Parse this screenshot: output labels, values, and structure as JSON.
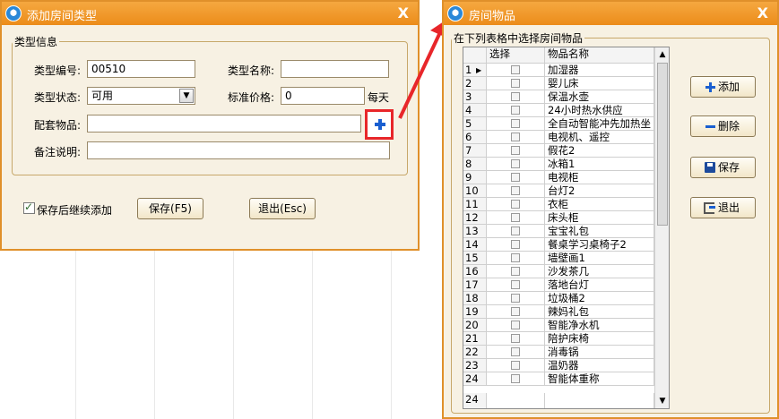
{
  "left_dialog": {
    "title": "添加房间类型",
    "close_label": "X",
    "group_title": "类型信息",
    "type_code_label": "类型编号:",
    "type_code_value": "00510",
    "type_name_label": "类型名称:",
    "type_name_value": "",
    "type_status_label": "类型状态:",
    "type_status_value": "可用",
    "price_label": "标准价格:",
    "price_value": "0",
    "price_unit": "每天",
    "items_label": "配套物品:",
    "items_value": "",
    "remark_label": "备注说明:",
    "remark_value": "",
    "continue_label": "保存后继续添加",
    "continue_checked": true,
    "save_label": "保存(F5)",
    "exit_label": "退出(Esc)"
  },
  "right_dialog": {
    "title": "房间物品",
    "close_label": "X",
    "group_title": "在下列表格中选择房间物品",
    "col_select": "选择",
    "col_name": "物品名称",
    "rows": [
      {
        "no": "1",
        "name": "加湿器"
      },
      {
        "no": "2",
        "name": "婴儿床"
      },
      {
        "no": "3",
        "name": "保温水壶"
      },
      {
        "no": "4",
        "name": "24小时热水供应"
      },
      {
        "no": "5",
        "name": "全自动智能冲先加热坐"
      },
      {
        "no": "6",
        "name": "电视机、遥控"
      },
      {
        "no": "7",
        "name": "假花2"
      },
      {
        "no": "8",
        "name": "冰箱1"
      },
      {
        "no": "9",
        "name": "电视柜"
      },
      {
        "no": "10",
        "name": "台灯2"
      },
      {
        "no": "11",
        "name": "衣柜"
      },
      {
        "no": "12",
        "name": "床头柜"
      },
      {
        "no": "13",
        "name": "宝宝礼包"
      },
      {
        "no": "14",
        "name": "餐桌学习桌椅子2"
      },
      {
        "no": "15",
        "name": "墙壁画1"
      },
      {
        "no": "16",
        "name": "沙发茶几"
      },
      {
        "no": "17",
        "name": "落地台灯"
      },
      {
        "no": "18",
        "name": "垃圾桶2"
      },
      {
        "no": "19",
        "name": "辣妈礼包"
      },
      {
        "no": "20",
        "name": "智能净水机"
      },
      {
        "no": "21",
        "name": "陪护床椅"
      },
      {
        "no": "22",
        "name": "消毒锅"
      },
      {
        "no": "23",
        "name": "温奶器"
      },
      {
        "no": "24",
        "name": "智能体重称"
      }
    ],
    "new_row_no": "24",
    "add_label": "添加",
    "delete_label": "删除",
    "save_label": "保存",
    "exit_label": "退出"
  },
  "colors": {
    "title_orange": "#ec8c1a",
    "window_bg": "#f7f1e3",
    "highlight_red": "#e8262a",
    "plus_blue": "#1a5fd0"
  }
}
